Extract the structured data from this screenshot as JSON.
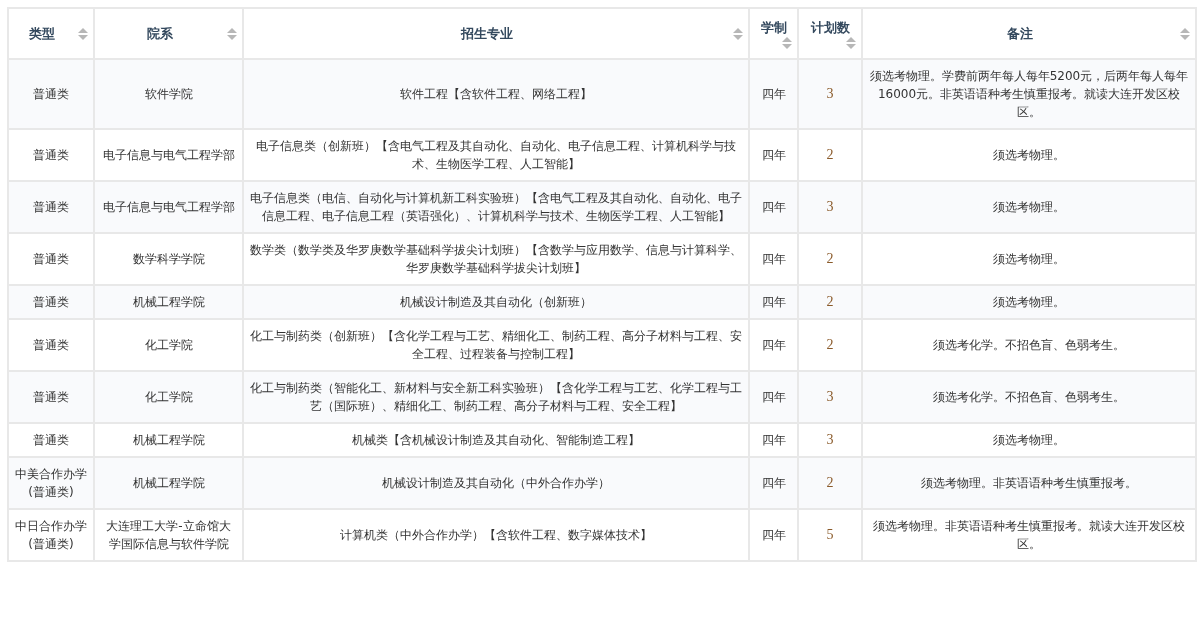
{
  "table": {
    "columns": [
      {
        "label": "类型"
      },
      {
        "label": "院系"
      },
      {
        "label": "招生专业"
      },
      {
        "label": "学制"
      },
      {
        "label": "计划数"
      },
      {
        "label": "备注"
      }
    ],
    "rows": [
      {
        "type": "普通类",
        "department": "软件学院",
        "major": "软件工程【含软件工程、网络工程】",
        "duration": "四年",
        "count": "3",
        "notes": "须选考物理。学费前两年每人每年5200元，后两年每人每年16000元。非英语语种考生慎重报考。就读大连开发区校区。"
      },
      {
        "type": "普通类",
        "department": "电子信息与电气工程学部",
        "major": "电子信息类（创新班）【含电气工程及其自动化、自动化、电子信息工程、计算机科学与技术、生物医学工程、人工智能】",
        "duration": "四年",
        "count": "2",
        "notes": "须选考物理。"
      },
      {
        "type": "普通类",
        "department": "电子信息与电气工程学部",
        "major": "电子信息类（电信、自动化与计算机新工科实验班）【含电气工程及其自动化、自动化、电子信息工程、电子信息工程（英语强化）、计算机科学与技术、生物医学工程、人工智能】",
        "duration": "四年",
        "count": "3",
        "notes": "须选考物理。"
      },
      {
        "type": "普通类",
        "department": "数学科学学院",
        "major": "数学类（数学类及华罗庚数学基础科学拔尖计划班）【含数学与应用数学、信息与计算科学、华罗庚数学基础科学拔尖计划班】",
        "duration": "四年",
        "count": "2",
        "notes": "须选考物理。"
      },
      {
        "type": "普通类",
        "department": "机械工程学院",
        "major": "机械设计制造及其自动化（创新班）",
        "duration": "四年",
        "count": "2",
        "notes": "须选考物理。"
      },
      {
        "type": "普通类",
        "department": "化工学院",
        "major": "化工与制药类（创新班）【含化学工程与工艺、精细化工、制药工程、高分子材料与工程、安全工程、过程装备与控制工程】",
        "duration": "四年",
        "count": "2",
        "notes": "须选考化学。不招色盲、色弱考生。"
      },
      {
        "type": "普通类",
        "department": "化工学院",
        "major": "化工与制药类（智能化工、新材料与安全新工科实验班）【含化学工程与工艺、化学工程与工艺（国际班）、精细化工、制药工程、高分子材料与工程、安全工程】",
        "duration": "四年",
        "count": "3",
        "notes": "须选考化学。不招色盲、色弱考生。"
      },
      {
        "type": "普通类",
        "department": "机械工程学院",
        "major": "机械类【含机械设计制造及其自动化、智能制造工程】",
        "duration": "四年",
        "count": "3",
        "notes": "须选考物理。"
      },
      {
        "type": "中美合作办学(普通类)",
        "department": "机械工程学院",
        "major": "机械设计制造及其自动化（中外合作办学）",
        "duration": "四年",
        "count": "2",
        "notes": "须选考物理。非英语语种考生慎重报考。"
      },
      {
        "type": "中日合作办学(普通类)",
        "department": "大连理工大学-立命馆大学国际信息与软件学院",
        "major": "计算机类（中外合作办学）【含软件工程、数字媒体技术】",
        "duration": "四年",
        "count": "5",
        "notes": "须选考物理。非英语语种考生慎重报考。就读大连开发区校区。"
      }
    ]
  }
}
